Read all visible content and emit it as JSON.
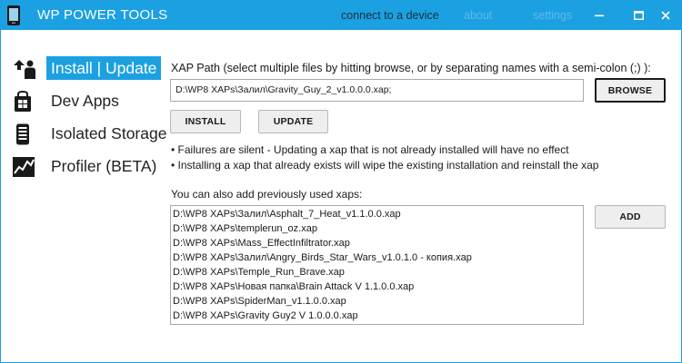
{
  "app": {
    "title": "WP POWER TOOLS",
    "connect_label": "connect to a device",
    "about_label": "about",
    "settings_label": "settings"
  },
  "colors": {
    "accent": "#1ba1e2",
    "connect_text": "#1e2f3a",
    "disabled_link": "#5fb9e6"
  },
  "nav": {
    "items": [
      {
        "label": "Install | Update",
        "icon": "install-update-icon",
        "active": true
      },
      {
        "label": "Dev Apps",
        "icon": "windows-store-icon",
        "active": false
      },
      {
        "label": "Isolated Storage",
        "icon": "phone-storage-icon",
        "active": false
      },
      {
        "label": "Profiler (BETA)",
        "icon": "chart-line-icon",
        "active": false
      }
    ]
  },
  "install": {
    "path_label": "XAP Path (select multiple files by hitting browse, or by separating names with a semi-colon (;) ):",
    "path_value": "D:\\WP8 XAPs\\Залил\\Gravity_Guy_2_v1.0.0.0.xap;",
    "browse_label": "BROWSE",
    "install_label": "INSTALL",
    "update_label": "UPDATE",
    "notes": [
      "• Failures are silent - Updating a xap that is not already installed will have no effect",
      "• Installing a xap that already exists will wipe the existing installation and reinstall the xap"
    ],
    "previous_label": "You can also add previously used xaps:",
    "add_label": "ADD",
    "previous_xaps": [
      "D:\\WP8 XAPs\\Залил\\Asphalt_7_Heat_v1.1.0.0.xap",
      "D:\\WP8 XAPs\\templerun_oz.xap",
      "D:\\WP8 XAPs\\Mass_EffectInfiltrator.xap",
      "D:\\WP8 XAPs\\Залил\\Angry_Birds_Star_Wars_v1.0.1.0 - копия.xap",
      "D:\\WP8 XAPs\\Temple_Run_Brave.xap",
      "D:\\WP8 XAPs\\Новая папка\\Brain Attack V 1.1.0.0.xap",
      "D:\\WP8 XAPs\\SpiderMan_v1.1.0.0.xap",
      "D:\\WP8 XAPs\\Gravity Guy2 V 1.0.0.0.xap"
    ]
  }
}
